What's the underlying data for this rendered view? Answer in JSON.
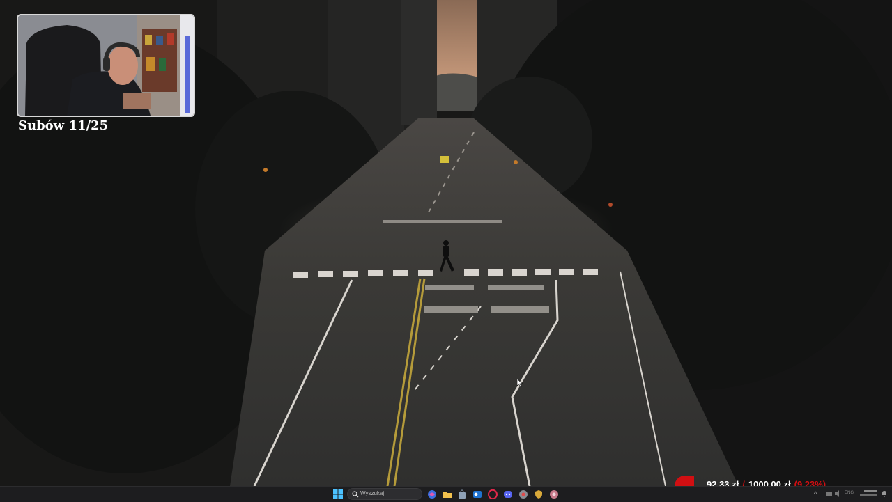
{
  "overlay": {
    "sub_counter": "Subów 11/25"
  },
  "goal": {
    "current": "92,33 zł",
    "separator": "/",
    "target": "1000,00 zł",
    "percent_text": "(9,23%)",
    "progress_fraction": 0.0923,
    "color": "#d10f12"
  },
  "taskbar": {
    "search_placeholder": "Wyszukaj",
    "apps": [
      "start-icon",
      "copilot-icon",
      "file-explorer-icon",
      "microsoft-store-icon",
      "outlook-icon",
      "opera-gx-icon",
      "discord-icon",
      "chrome-icon",
      "shield-app-icon",
      "game-app-icon"
    ],
    "tray": {
      "chevron": "^",
      "lang": "ENG"
    }
  },
  "colors": {
    "taskbar_bg": "#1d1d1f",
    "accent_red": "#d10f12"
  }
}
